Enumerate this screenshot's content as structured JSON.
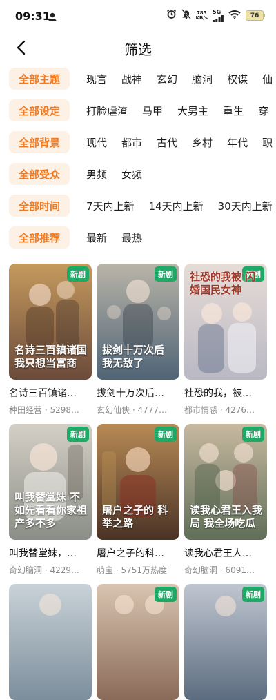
{
  "status": {
    "time": "09:31",
    "net_speed_value": "785",
    "net_speed_unit": "KB/s",
    "network": "5G",
    "battery": "76"
  },
  "header": {
    "title": "筛选"
  },
  "filters": [
    {
      "label": "全部主题",
      "options": [
        "现言",
        "战神",
        "玄幻",
        "脑洞",
        "权谋",
        "仙"
      ]
    },
    {
      "label": "全部设定",
      "options": [
        "打脸虐渣",
        "马甲",
        "大男主",
        "重生",
        "穿"
      ]
    },
    {
      "label": "全部背景",
      "options": [
        "现代",
        "都市",
        "古代",
        "乡村",
        "年代",
        "职"
      ]
    },
    {
      "label": "全部受众",
      "options": [
        "男频",
        "女频"
      ]
    },
    {
      "label": "全部时间",
      "options": [
        "7天内上新",
        "14天内上新",
        "30天内上新"
      ]
    },
    {
      "label": "全部推荐",
      "options": [
        "最新",
        "最热"
      ]
    }
  ],
  "cards": [
    {
      "badge": "新剧",
      "poster_text": "名诗三百镇诸国 我只想当富商",
      "title": "名诗三百镇诸…",
      "meta": "种田经营 · 5298…",
      "color1": "#6b4a3a",
      "color2": "#c59a5e"
    },
    {
      "badge": "新剧",
      "poster_text": "拔剑十万次后 我无敌了",
      "title": "拔剑十万次后…",
      "meta": "玄幻仙侠 · 4777…",
      "color1": "#4f6476",
      "color2": "#b9b4a8"
    },
    {
      "badge": "新剧",
      "poster_text": "社恐的我被 闪婚国民女神",
      "title": "社恐的我，被…",
      "meta": "都市情感 · 4276…",
      "color1": "#b9b8c4",
      "color2": "#e6dcd6"
    },
    {
      "badge": "新剧",
      "poster_text": "叫我替堂妹 不如先看看你家祖产多不多",
      "title": "叫我替堂妹，…",
      "meta": "奇幻脑洞 · 4229…",
      "color1": "#8a8e86",
      "color2": "#d4cfc6"
    },
    {
      "badge": "新剧",
      "poster_text": "屠户之子的 科举之路",
      "title": "屠户之子的科…",
      "meta": "萌宝 · 5751万热度",
      "color1": "#4a3326",
      "color2": "#b88a55"
    },
    {
      "badge": "新剧",
      "poster_text": "读我心君王入我局 我全场吃瓜",
      "title": "读我心君王人…",
      "meta": "奇幻脑洞 · 6091…",
      "color1": "#5f6f58",
      "color2": "#c8b8a0"
    },
    {
      "badge": "",
      "poster_text": "",
      "title": "",
      "meta": "",
      "color1": "#7c8e9c",
      "color2": "#c9d2d8"
    },
    {
      "badge": "新剧",
      "poster_text": "",
      "title": "",
      "meta": "",
      "color1": "#8a6a58",
      "color2": "#d8c4b0"
    },
    {
      "badge": "新剧",
      "poster_text": "",
      "title": "",
      "meta": "",
      "color1": "#5c6c80",
      "color2": "#c0c6d0"
    }
  ],
  "colors": {
    "accent": "#f07a22",
    "chip_bg": "#fdf1e6",
    "badge": "#1fa966"
  }
}
